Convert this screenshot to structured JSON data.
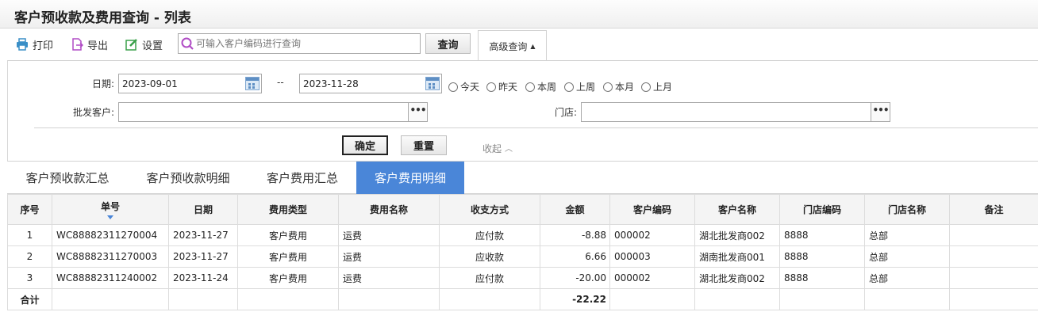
{
  "app": {
    "title": "客户预收款及费用查询 - 列表"
  },
  "toolbar": {
    "print_label": "打印",
    "export_label": "导出",
    "settings_label": "设置",
    "search_placeholder": "可输入客户编码进行查询",
    "query_label": "查询",
    "advanced_label": "高级查询"
  },
  "filters": {
    "date_label": "日期:",
    "date_from": "2023-09-01",
    "date_sep": "--",
    "date_to": "2023-11-28",
    "quick_dates": [
      "今天",
      "昨天",
      "本周",
      "上周",
      "本月",
      "上月"
    ],
    "customer_label": "批发客户:",
    "customer_value": "",
    "store_label": "门店:",
    "store_value": "",
    "ok_label": "确定",
    "reset_label": "重置",
    "collapse_label": "收起"
  },
  "tabs": [
    "客户预收款汇总",
    "客户预收款明细",
    "客户费用汇总",
    "客户费用明细"
  ],
  "active_tab": 3,
  "accent_color": "#4a86d8",
  "table": {
    "headers": [
      "序号",
      "单号",
      "日期",
      "费用类型",
      "费用名称",
      "收支方式",
      "金额",
      "客户编码",
      "客户名称",
      "门店编码",
      "门店名称",
      "备注"
    ],
    "rows": [
      [
        "1",
        "WC88882311270004",
        "2023-11-27",
        "客户费用",
        "运费",
        "应付款",
        "-8.88",
        "000002",
        "湖北批发商002",
        "8888",
        "总部",
        ""
      ],
      [
        "2",
        "WC88882311270003",
        "2023-11-27",
        "客户费用",
        "运费",
        "应收款",
        "6.66",
        "000003",
        "湖南批发商001",
        "8888",
        "总部",
        ""
      ],
      [
        "3",
        "WC88882311240002",
        "2023-11-24",
        "客户费用",
        "运费",
        "应付款",
        "-20.00",
        "000002",
        "湖北批发商002",
        "8888",
        "总部",
        ""
      ]
    ],
    "total_label": "合计",
    "total_amount": "-22.22"
  }
}
